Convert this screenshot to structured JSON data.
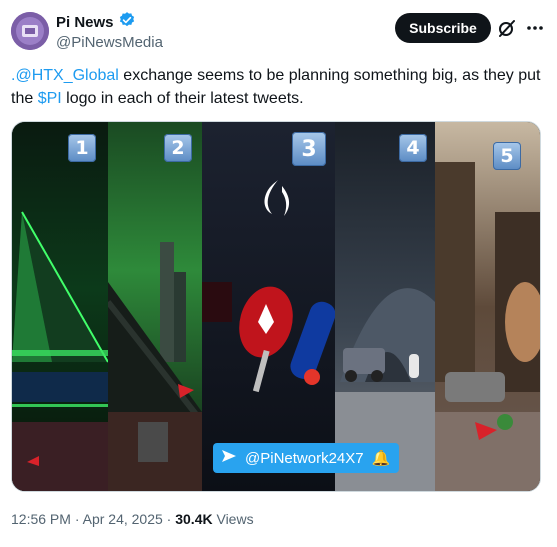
{
  "author": {
    "name": "Pi News",
    "handle": "@PiNewsMedia"
  },
  "actions": {
    "subscribe_label": "Subscribe"
  },
  "tweet": {
    "mention": ".@HTX_Global",
    "text_part1": " exchange seems to be planning something big, as they put the ",
    "cashtag": "$PI",
    "text_part2": " logo in each of their latest tweets."
  },
  "media": {
    "panel_numbers": [
      "1",
      "2",
      "3",
      "4",
      "5"
    ],
    "overlay_handle": "@PiNetwork24X7",
    "overlay_emoji": "🔔"
  },
  "meta": {
    "time": "12:56 PM",
    "separator": " · ",
    "date": "Apr 24, 2025",
    "views_count": "30.4K",
    "views_label": " Views"
  },
  "colors": {
    "link": "#1d9bf0",
    "verified": "#1d9bf0",
    "subscribe_bg": "#0f1419"
  },
  "icons": {
    "verified": "verified-badge-icon",
    "grok": "grok-icon",
    "more": "more-icon",
    "send": "send-arrow-icon",
    "bell": "bell-icon"
  }
}
